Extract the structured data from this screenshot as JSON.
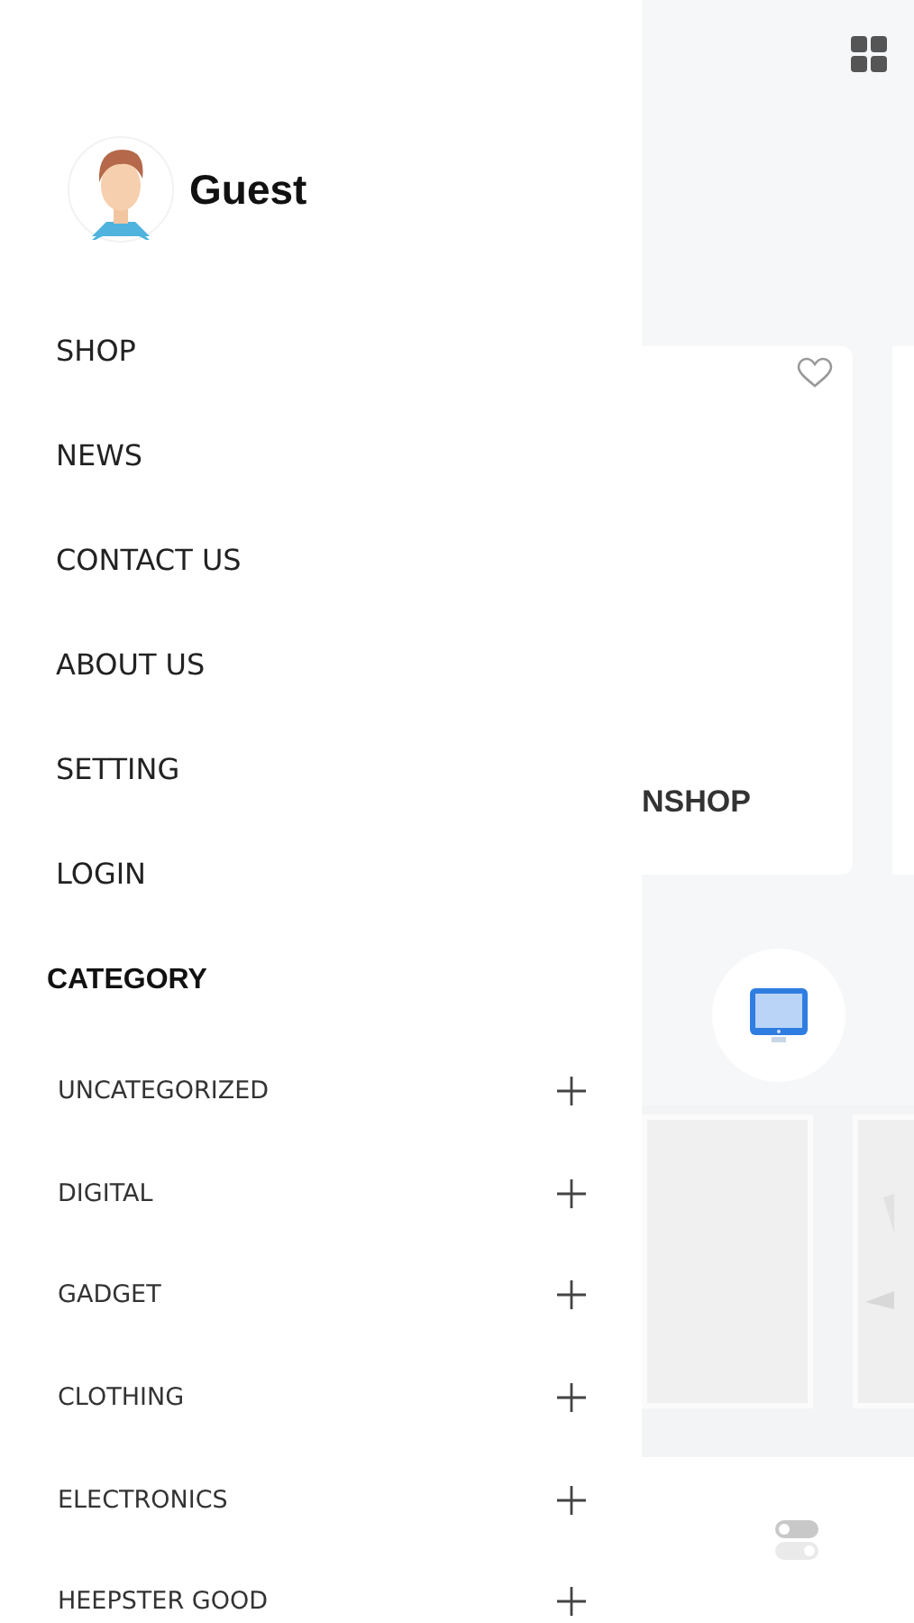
{
  "user": {
    "name": "Guest"
  },
  "menu": [
    {
      "label": "SHOP"
    },
    {
      "label": "NEWS"
    },
    {
      "label": "CONTACT US"
    },
    {
      "label": "ABOUT US"
    },
    {
      "label": "SETTING"
    },
    {
      "label": "LOGIN"
    }
  ],
  "category": {
    "title": "CATEGORY",
    "items": [
      {
        "label": "UNCATEGORIZED",
        "expanded": false
      },
      {
        "label": "DIGITAL",
        "expanded": false
      },
      {
        "label": "GADGET",
        "expanded": false
      },
      {
        "label": "CLOTHING",
        "expanded": false
      },
      {
        "label": "ELECTRONICS",
        "expanded": false
      },
      {
        "label": "HEEPSTER GOOD",
        "expanded": false
      }
    ]
  },
  "background": {
    "product_card": {
      "title": "NSHOP",
      "favorite": false
    }
  }
}
